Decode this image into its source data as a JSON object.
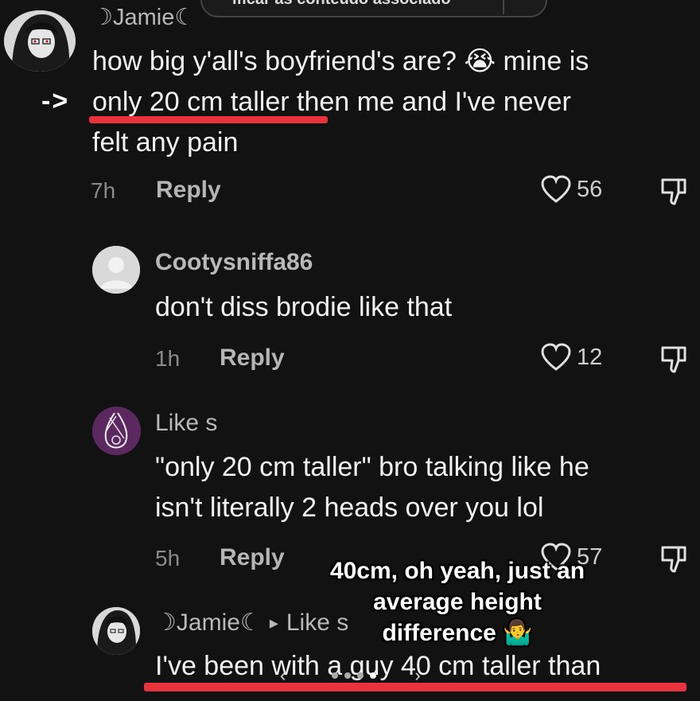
{
  "search_bar": {
    "text": "ificar as conteúdo associado"
  },
  "comments": [
    {
      "username": "☽Jamie☾",
      "text_line1": "how big y'all's boyfriend's are? 😭 mine is",
      "text_line2a": "only 20 cm taller",
      "text_line2b": " then me and I've never",
      "text_line3": "felt any pain",
      "time": "7h",
      "reply_label": "Reply",
      "likes": "56"
    },
    {
      "username": "Cootysniffa86",
      "text": "don't diss brodie like that",
      "time": "1h",
      "reply_label": "Reply",
      "likes": "12"
    },
    {
      "username": "Like s",
      "text_line1": "\"only 20 cm taller\" bro talking like he",
      "text_line2": "isn't literally 2 heads over you lol",
      "time": "5h",
      "reply_label": "Reply",
      "likes": "57"
    },
    {
      "username": "☽Jamie☾",
      "reply_arrow": "▸",
      "reply_to": "Like s",
      "text": "I've been with a guy 40 cm taller than"
    }
  ],
  "annotation": {
    "arrow": "->",
    "overlay_line1": "40cm, oh yeah, just an",
    "overlay_line2": "average height",
    "overlay_line3": "difference 🤷‍♂️",
    "nav_left": "‹",
    "nav_right": "›"
  },
  "colors": {
    "background": "#121212",
    "underline": "#e8323c",
    "muted": "#8a8a8a"
  },
  "icons": [
    "heart-icon",
    "dislike-icon",
    "search-icon"
  ]
}
